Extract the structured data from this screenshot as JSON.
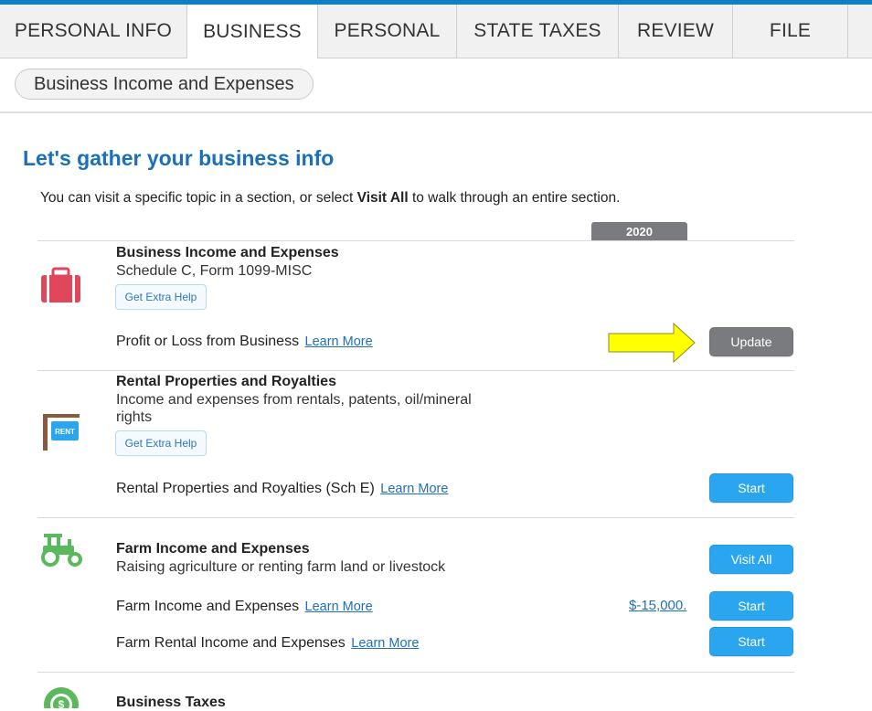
{
  "tabs": [
    {
      "label": "PERSONAL INFO"
    },
    {
      "label": "BUSINESS",
      "active": true
    },
    {
      "label": "PERSONAL"
    },
    {
      "label": "STATE TAXES"
    },
    {
      "label": "REVIEW"
    },
    {
      "label": "FILE"
    }
  ],
  "breadcrumb": {
    "label": "Business Income and Expenses"
  },
  "page": {
    "title": "Let's gather your business info",
    "intro_pre": "You can visit a specific topic in a section, or select ",
    "intro_bold": "Visit All",
    "intro_post": " to walk through an entire section.",
    "year_header": "2020"
  },
  "sections": {
    "business": {
      "icon": "briefcase-icon",
      "title": "Business Income and Expenses",
      "subtitle": "Schedule C, Form 1099-MISC",
      "help_label": "Get Extra Help",
      "rows": [
        {
          "label": "Profit or Loss from Business",
          "link": "Learn More",
          "button": "Update"
        }
      ]
    },
    "rental": {
      "icon": "rent-sign-icon",
      "title": "Rental Properties and Royalties",
      "subtitle_line1": "Income and expenses from rentals, patents, oil/mineral",
      "subtitle_line2": "rights",
      "help_label": "Get Extra Help",
      "icon_text": "RENT",
      "rows": [
        {
          "label": "Rental Properties and Royalties (Sch E)",
          "link": "Learn More",
          "button": "Start"
        }
      ]
    },
    "farm": {
      "icon": "tractor-icon",
      "title": "Farm Income and Expenses",
      "subtitle": "Raising agriculture or renting farm land or livestock",
      "visit_all": "Visit All",
      "rows": [
        {
          "label": "Farm Income and Expenses",
          "link": "Learn More",
          "amount": "$-15,000.",
          "button": "Start"
        },
        {
          "label": "Farm Rental Income and Expenses",
          "link": "Learn More",
          "button": "Start"
        }
      ]
    },
    "taxes": {
      "icon": "dollar-circle-icon",
      "title": "Business Taxes"
    }
  },
  "colors": {
    "brand_blue": "#0d7fc9",
    "button_blue": "#2aa6f0",
    "button_gray": "#7a7b7e",
    "title_blue": "#1a70b8",
    "briefcase_red": "#e0475b",
    "tractor_green": "#5cb85c",
    "arrow_yellow": "#ffff00"
  }
}
